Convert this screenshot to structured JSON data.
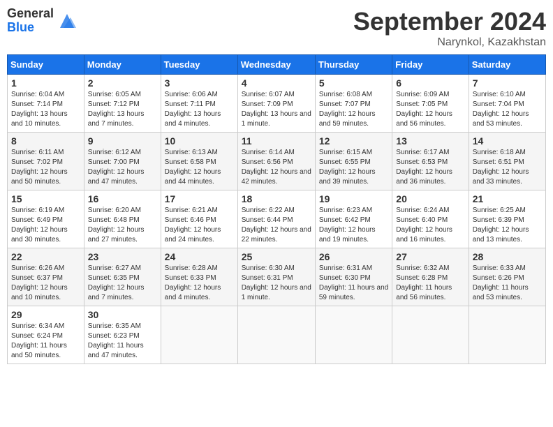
{
  "logo": {
    "general": "General",
    "blue": "Blue"
  },
  "title": "September 2024",
  "location": "Narynkol, Kazakhstan",
  "days_header": [
    "Sunday",
    "Monday",
    "Tuesday",
    "Wednesday",
    "Thursday",
    "Friday",
    "Saturday"
  ],
  "weeks": [
    [
      {
        "day": "1",
        "sunrise": "6:04 AM",
        "sunset": "7:14 PM",
        "daylight": "13 hours and 10 minutes."
      },
      {
        "day": "2",
        "sunrise": "6:05 AM",
        "sunset": "7:12 PM",
        "daylight": "13 hours and 7 minutes."
      },
      {
        "day": "3",
        "sunrise": "6:06 AM",
        "sunset": "7:11 PM",
        "daylight": "13 hours and 4 minutes."
      },
      {
        "day": "4",
        "sunrise": "6:07 AM",
        "sunset": "7:09 PM",
        "daylight": "13 hours and 1 minute."
      },
      {
        "day": "5",
        "sunrise": "6:08 AM",
        "sunset": "7:07 PM",
        "daylight": "12 hours and 59 minutes."
      },
      {
        "day": "6",
        "sunrise": "6:09 AM",
        "sunset": "7:05 PM",
        "daylight": "12 hours and 56 minutes."
      },
      {
        "day": "7",
        "sunrise": "6:10 AM",
        "sunset": "7:04 PM",
        "daylight": "12 hours and 53 minutes."
      }
    ],
    [
      {
        "day": "8",
        "sunrise": "6:11 AM",
        "sunset": "7:02 PM",
        "daylight": "12 hours and 50 minutes."
      },
      {
        "day": "9",
        "sunrise": "6:12 AM",
        "sunset": "7:00 PM",
        "daylight": "12 hours and 47 minutes."
      },
      {
        "day": "10",
        "sunrise": "6:13 AM",
        "sunset": "6:58 PM",
        "daylight": "12 hours and 44 minutes."
      },
      {
        "day": "11",
        "sunrise": "6:14 AM",
        "sunset": "6:56 PM",
        "daylight": "12 hours and 42 minutes."
      },
      {
        "day": "12",
        "sunrise": "6:15 AM",
        "sunset": "6:55 PM",
        "daylight": "12 hours and 39 minutes."
      },
      {
        "day": "13",
        "sunrise": "6:17 AM",
        "sunset": "6:53 PM",
        "daylight": "12 hours and 36 minutes."
      },
      {
        "day": "14",
        "sunrise": "6:18 AM",
        "sunset": "6:51 PM",
        "daylight": "12 hours and 33 minutes."
      }
    ],
    [
      {
        "day": "15",
        "sunrise": "6:19 AM",
        "sunset": "6:49 PM",
        "daylight": "12 hours and 30 minutes."
      },
      {
        "day": "16",
        "sunrise": "6:20 AM",
        "sunset": "6:48 PM",
        "daylight": "12 hours and 27 minutes."
      },
      {
        "day": "17",
        "sunrise": "6:21 AM",
        "sunset": "6:46 PM",
        "daylight": "12 hours and 24 minutes."
      },
      {
        "day": "18",
        "sunrise": "6:22 AM",
        "sunset": "6:44 PM",
        "daylight": "12 hours and 22 minutes."
      },
      {
        "day": "19",
        "sunrise": "6:23 AM",
        "sunset": "6:42 PM",
        "daylight": "12 hours and 19 minutes."
      },
      {
        "day": "20",
        "sunrise": "6:24 AM",
        "sunset": "6:40 PM",
        "daylight": "12 hours and 16 minutes."
      },
      {
        "day": "21",
        "sunrise": "6:25 AM",
        "sunset": "6:39 PM",
        "daylight": "12 hours and 13 minutes."
      }
    ],
    [
      {
        "day": "22",
        "sunrise": "6:26 AM",
        "sunset": "6:37 PM",
        "daylight": "12 hours and 10 minutes."
      },
      {
        "day": "23",
        "sunrise": "6:27 AM",
        "sunset": "6:35 PM",
        "daylight": "12 hours and 7 minutes."
      },
      {
        "day": "24",
        "sunrise": "6:28 AM",
        "sunset": "6:33 PM",
        "daylight": "12 hours and 4 minutes."
      },
      {
        "day": "25",
        "sunrise": "6:30 AM",
        "sunset": "6:31 PM",
        "daylight": "12 hours and 1 minute."
      },
      {
        "day": "26",
        "sunrise": "6:31 AM",
        "sunset": "6:30 PM",
        "daylight": "11 hours and 59 minutes."
      },
      {
        "day": "27",
        "sunrise": "6:32 AM",
        "sunset": "6:28 PM",
        "daylight": "11 hours and 56 minutes."
      },
      {
        "day": "28",
        "sunrise": "6:33 AM",
        "sunset": "6:26 PM",
        "daylight": "11 hours and 53 minutes."
      }
    ],
    [
      {
        "day": "29",
        "sunrise": "6:34 AM",
        "sunset": "6:24 PM",
        "daylight": "11 hours and 50 minutes."
      },
      {
        "day": "30",
        "sunrise": "6:35 AM",
        "sunset": "6:23 PM",
        "daylight": "11 hours and 47 minutes."
      },
      null,
      null,
      null,
      null,
      null
    ]
  ]
}
